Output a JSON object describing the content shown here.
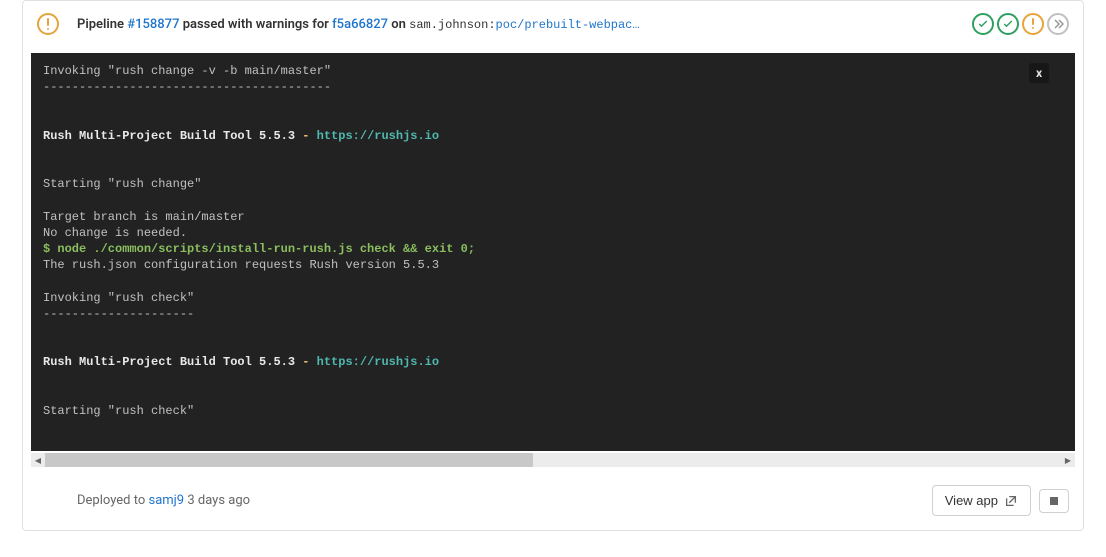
{
  "header": {
    "pipeline_label": "Pipeline",
    "pipeline_id": "#158877",
    "status_text": "passed with warnings for",
    "commit_sha": "f5a66827",
    "on_text": "on",
    "user": "sam.johnson",
    "sep": ":",
    "branch": "poc/prebuilt-webpac…"
  },
  "terminal": {
    "line1": "Invoking \"rush change -v -b main/master\"",
    "line2": "----------------------------------------",
    "line3": "",
    "line4": "",
    "line5a": "Rush Multi-Project Build Tool 5.5.3",
    "line5b": " - ",
    "line5c": "https://rushjs.io",
    "line6": "",
    "line7": "",
    "line8": "Starting \"rush change\"",
    "line9": "",
    "line10": "Target branch is main/master",
    "line11": "No change is needed.",
    "line12": "$ node ./common/scripts/install-run-rush.js check && exit 0;",
    "line13": "The rush.json configuration requests Rush version 5.5.3",
    "line14": "",
    "line15": "Invoking \"rush check\"",
    "line16": "---------------------",
    "line17": "",
    "line18": "",
    "line19a": "Rush Multi-Project Build Tool 5.5.3",
    "line19b": " - ",
    "line19c": "https://rushjs.io",
    "line20": "",
    "line21": "",
    "line22": "Starting \"rush check\"",
    "close_label": "x"
  },
  "footer": {
    "deployed_text": "Deployed to",
    "env_name": "samj9",
    "time_ago": "3 days ago",
    "view_app_label": "View app"
  }
}
